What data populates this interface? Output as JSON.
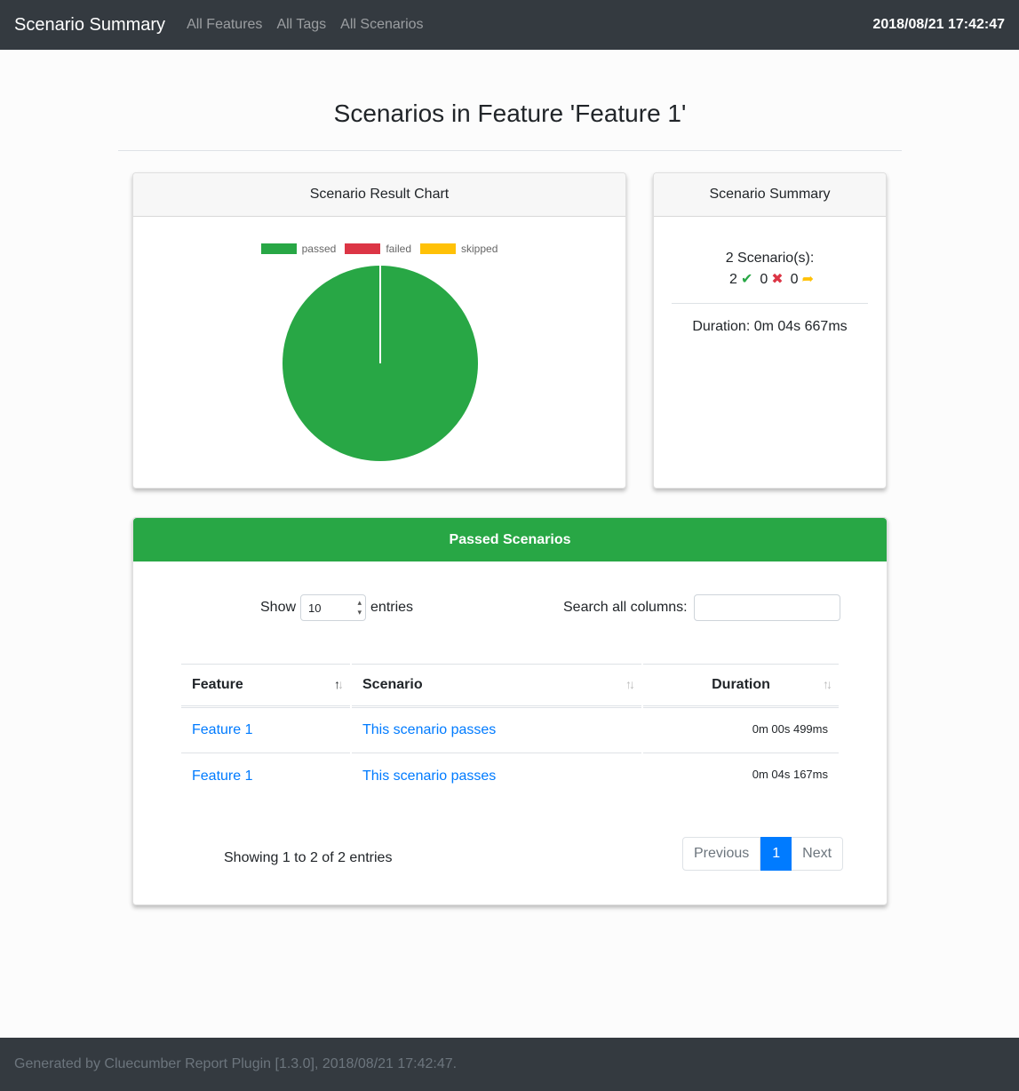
{
  "nav": {
    "brand": "Scenario Summary",
    "links": [
      "All Features",
      "All Tags",
      "All Scenarios"
    ],
    "timestamp": "2018/08/21 17:42:47"
  },
  "page": {
    "title": "Scenarios in Feature 'Feature 1'"
  },
  "chart_card": {
    "title": "Scenario Result Chart"
  },
  "chart_data": {
    "type": "pie",
    "title": "",
    "categories": [
      "passed",
      "failed",
      "skipped"
    ],
    "values": [
      2,
      0,
      0
    ],
    "colors": [
      "#28a745",
      "#dc3545",
      "#ffc107"
    ],
    "legend_position": "top"
  },
  "summary_card": {
    "title": "Scenario Summary",
    "total_label": "2 Scenario(s):",
    "passed": "2",
    "failed": "0",
    "skipped": "0",
    "duration": "Duration: 0m 04s 667ms"
  },
  "table_card": {
    "title": "Passed Scenarios",
    "show_label": "Show",
    "entries_value": "10",
    "entries_label": "entries",
    "search_label": "Search all columns:",
    "search_value": "",
    "columns": [
      "Feature",
      "Scenario",
      "Duration"
    ],
    "rows": [
      {
        "feature": "Feature 1",
        "scenario": "This scenario passes",
        "duration": "0m 00s 499ms"
      },
      {
        "feature": "Feature 1",
        "scenario": "This scenario passes",
        "duration": "0m 04s 167ms"
      }
    ],
    "info": "Showing 1 to 2 of 2 entries",
    "pager": {
      "previous": "Previous",
      "current": "1",
      "next": "Next"
    }
  },
  "footer": {
    "text": "Generated by Cluecumber Report Plugin [1.3.0], 2018/08/21 17:42:47."
  }
}
